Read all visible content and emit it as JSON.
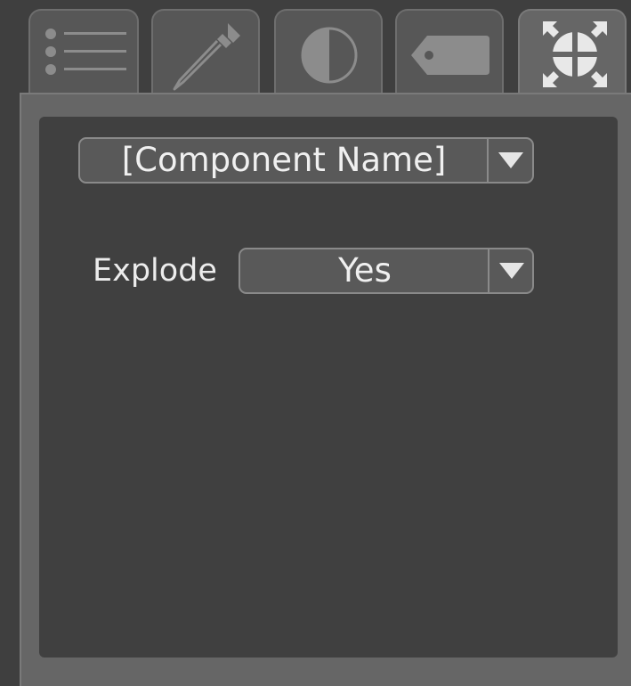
{
  "tabs": [
    {
      "icon": "list-icon",
      "active": false
    },
    {
      "icon": "eyedropper-icon",
      "active": false
    },
    {
      "icon": "contrast-icon",
      "active": false
    },
    {
      "icon": "tag-icon",
      "active": false
    },
    {
      "icon": "explode-icon",
      "active": true
    }
  ],
  "component_select": {
    "value": "[Component Name]"
  },
  "explode": {
    "label": "Explode",
    "value": "Yes"
  },
  "colors": {
    "background": "#3f3f3f",
    "tab": "#575757",
    "tab_active": "#666666",
    "panel": "#404040",
    "icon": "#8c8c8c",
    "icon_active": "#e8e8e8"
  }
}
